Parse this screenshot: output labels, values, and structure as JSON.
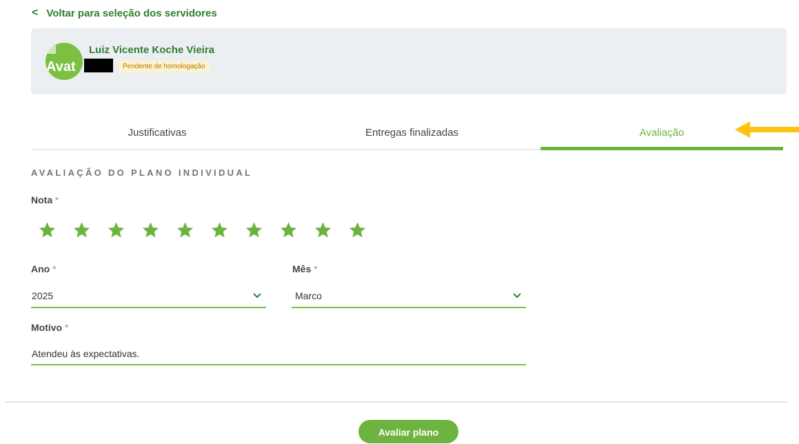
{
  "back_link": {
    "label": "Voltar para seleção dos servidores",
    "icon": "chevron-left-icon"
  },
  "user_card": {
    "name": "Luiz Vicente Koche Vieira",
    "avatar_alt": "Avat",
    "status": "Pendente de homologação"
  },
  "tabs": [
    {
      "label": "Justificativas",
      "active": false
    },
    {
      "label": "Entregas finalizadas",
      "active": false
    },
    {
      "label": "Avaliação",
      "active": true
    }
  ],
  "annotation": {
    "icon": "yellow-arrow-icon",
    "color": "#ffc20e"
  },
  "form": {
    "section_title": "AVALIAÇÃO DO PLANO INDIVIDUAL",
    "nota": {
      "label": "Nota",
      "required": "*",
      "stars_total": 10,
      "stars_filled": 10
    },
    "ano": {
      "label": "Ano",
      "required": "*",
      "value": "2025"
    },
    "mes": {
      "label": "Mês",
      "required": "*",
      "value": "Marco"
    },
    "motivo": {
      "label": "Motivo",
      "required": "*",
      "value": "Atendeu às expectativas."
    }
  },
  "footer": {
    "submit_label": "Avaliar plano"
  },
  "colors": {
    "accent": "#6db33f",
    "dark_green": "#2e7d32",
    "card_bg": "#eceff1",
    "badge_bg": "#fff3cd"
  }
}
